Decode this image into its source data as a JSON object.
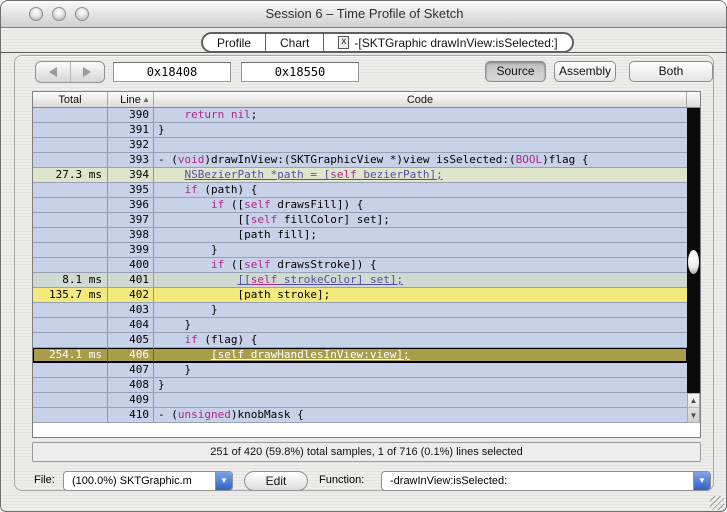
{
  "window": {
    "title": "Session 6 – Time Profile of Sketch"
  },
  "tabs": {
    "items": [
      {
        "label": "Profile"
      },
      {
        "label": "Chart"
      }
    ],
    "active": {
      "close_label": "x",
      "label": "-[SKTGraphic drawInView:isSelected:]"
    }
  },
  "toolbar": {
    "address_start": "0x18408",
    "address_end": "0x18550",
    "view_buttons": [
      {
        "label": "Source",
        "selected": true
      },
      {
        "label": "Assembly",
        "selected": false
      },
      {
        "label": "Both",
        "selected": false
      }
    ]
  },
  "table": {
    "headers": {
      "total": "Total",
      "line": "Line",
      "code": "Code"
    },
    "sort_indicator": "▲",
    "rows": [
      {
        "line": 390,
        "total": "",
        "bg": "normal",
        "indent": 4,
        "segments": [
          [
            "kw",
            "return"
          ],
          [
            "pl",
            " "
          ],
          [
            "kw",
            "nil"
          ],
          [
            "pl",
            ";"
          ]
        ]
      },
      {
        "line": 391,
        "total": "",
        "bg": "normal",
        "indent": 0,
        "segments": [
          [
            "pl",
            "}"
          ]
        ]
      },
      {
        "line": 392,
        "total": "",
        "bg": "normal",
        "indent": 0,
        "segments": []
      },
      {
        "line": 393,
        "total": "",
        "bg": "normal",
        "indent": 0,
        "segments": [
          [
            "pl",
            "- ("
          ],
          [
            "kw",
            "void"
          ],
          [
            "pl",
            ")drawInView:(SKTGraphicView *)view isSelected:("
          ],
          [
            "kw",
            "BOOL"
          ],
          [
            "pl",
            ")flag {"
          ]
        ]
      },
      {
        "line": 394,
        "total": "27.3 ms",
        "bg": "pale",
        "indent": 4,
        "segments": [
          [
            "lk",
            "NSBezierPath *path = ["
          ],
          [
            "lkw",
            "self"
          ],
          [
            "lk",
            " bezierPath];"
          ]
        ]
      },
      {
        "line": 395,
        "total": "",
        "bg": "normal",
        "indent": 4,
        "segments": [
          [
            "kw",
            "if"
          ],
          [
            "pl",
            " (path) {"
          ]
        ]
      },
      {
        "line": 396,
        "total": "",
        "bg": "normal",
        "indent": 8,
        "segments": [
          [
            "kw",
            "if"
          ],
          [
            "pl",
            " (["
          ],
          [
            "kw",
            "self"
          ],
          [
            "pl",
            " drawsFill]) {"
          ]
        ]
      },
      {
        "line": 397,
        "total": "",
        "bg": "normal",
        "indent": 12,
        "segments": [
          [
            "pl",
            "[["
          ],
          [
            "kw",
            "self"
          ],
          [
            "pl",
            " fillColor] set];"
          ]
        ]
      },
      {
        "line": 398,
        "total": "",
        "bg": "normal",
        "indent": 12,
        "segments": [
          [
            "pl",
            "[path fill];"
          ]
        ]
      },
      {
        "line": 399,
        "total": "",
        "bg": "normal",
        "indent": 8,
        "segments": [
          [
            "pl",
            "}"
          ]
        ]
      },
      {
        "line": 400,
        "total": "",
        "bg": "normal",
        "indent": 8,
        "segments": [
          [
            "kw",
            "if"
          ],
          [
            "pl",
            " (["
          ],
          [
            "kw",
            "self"
          ],
          [
            "pl",
            " drawsStroke]) {"
          ]
        ]
      },
      {
        "line": 401,
        "total": "8.1 ms",
        "bg": "mid",
        "indent": 12,
        "segments": [
          [
            "lk",
            "[["
          ],
          [
            "lkw",
            "self"
          ],
          [
            "lk",
            " strokeColor] set];"
          ]
        ]
      },
      {
        "line": 402,
        "total": "135.7 ms",
        "bg": "hot",
        "indent": 12,
        "segments": [
          [
            "pl",
            "[path stroke];"
          ]
        ]
      },
      {
        "line": 403,
        "total": "",
        "bg": "normal",
        "indent": 8,
        "segments": [
          [
            "pl",
            "}"
          ]
        ]
      },
      {
        "line": 404,
        "total": "",
        "bg": "normal",
        "indent": 4,
        "segments": [
          [
            "pl",
            "}"
          ]
        ]
      },
      {
        "line": 405,
        "total": "",
        "bg": "normal",
        "indent": 4,
        "segments": [
          [
            "kw",
            "if"
          ],
          [
            "pl",
            " (flag) {"
          ]
        ]
      },
      {
        "line": 406,
        "total": "254.1 ms",
        "bg": "sel",
        "indent": 8,
        "segments": [
          [
            "lk",
            "[self drawHandlesInView:view];"
          ]
        ]
      },
      {
        "line": 407,
        "total": "",
        "bg": "normal",
        "indent": 4,
        "segments": [
          [
            "pl",
            "}"
          ]
        ]
      },
      {
        "line": 408,
        "total": "",
        "bg": "normal",
        "indent": 0,
        "segments": [
          [
            "pl",
            "}"
          ]
        ]
      },
      {
        "line": 409,
        "total": "",
        "bg": "normal",
        "indent": 0,
        "segments": []
      },
      {
        "line": 410,
        "total": "",
        "bg": "normal",
        "indent": 0,
        "segments": [
          [
            "pl",
            "- ("
          ],
          [
            "kw",
            "unsigned"
          ],
          [
            "pl",
            ")knobMask {"
          ]
        ]
      }
    ]
  },
  "status": {
    "text": "251 of 420 (59.8%) total samples, 1 of 716 (0.1%) lines selected"
  },
  "footer": {
    "file_label": "File:",
    "file_value": "(100.0%) SKTGraphic.m",
    "edit_label": "Edit",
    "function_label": "Function:",
    "function_value": "-drawInView:isSelected:"
  },
  "colors": {
    "row_default": "#c7d2e8",
    "row_sample_low": "#cfdad2",
    "row_sample_med": "#dee5cb",
    "row_sample_hot": "#f3ea7e",
    "row_selected": "#a89d49",
    "keyword": "#b0268c",
    "link": "#544ea6",
    "popup_arrow_blue": "#2f62c4"
  }
}
